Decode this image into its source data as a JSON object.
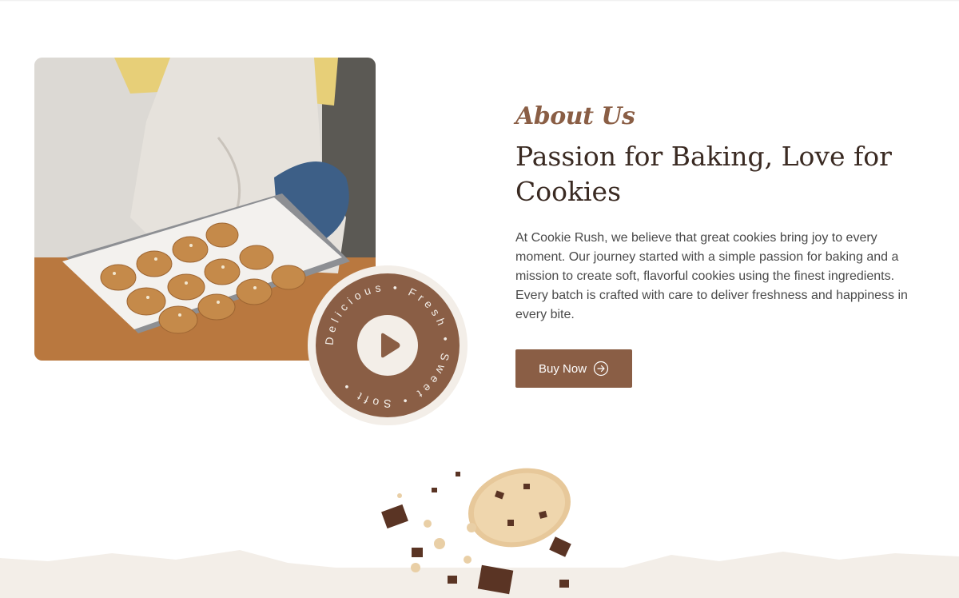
{
  "about": {
    "eyebrow": "About Us",
    "heading": "Passion for Baking, Love for Cookies",
    "body": "At Cookie Rush, we believe that great cookies bring joy to every moment. Our journey started with a simple passion for baking and a mission to create soft, flavorful cookies using the finest ingredients. Every batch is crafted with care to deliver freshness and happiness in every bite.",
    "button_label": "Buy Now",
    "button_icon": "arrow-circle-right-icon"
  },
  "badge": {
    "ring_text": "Delicious • Fresh • Sweet • Soft •",
    "play_icon": "play-icon"
  },
  "colors": {
    "accent": "#8a5e45",
    "cream": "#f3eee8",
    "heading": "#3a2a22"
  },
  "images": {
    "hero_photo": "baker holding tray of oat cookies",
    "bottom_decor": "broken chocolate chunk cookie"
  }
}
